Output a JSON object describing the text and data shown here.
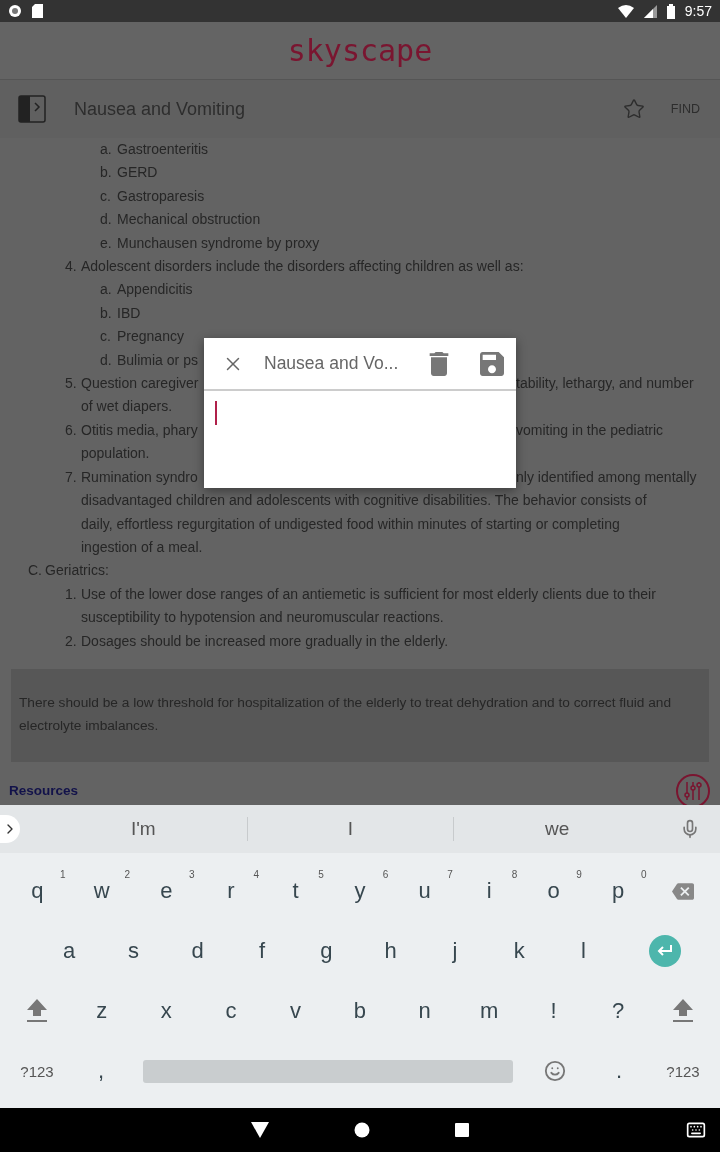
{
  "status_bar": {
    "time": "9:57"
  },
  "app_bar": {
    "logo": "skyscape"
  },
  "title_bar": {
    "title": "Nausea and Vomiting",
    "find": "FIND"
  },
  "content": {
    "blocks": [
      {
        "kind": "sub",
        "marker": "a.",
        "text": "Gastroenteritis"
      },
      {
        "kind": "sub",
        "marker": "b.",
        "text": "GERD"
      },
      {
        "kind": "sub",
        "marker": "c.",
        "text": "Gastroparesis"
      },
      {
        "kind": "sub",
        "marker": "d.",
        "text": "Mechanical obstruction"
      },
      {
        "kind": "sub",
        "marker": "e.",
        "text": "Munchausen syndrome by proxy"
      },
      {
        "kind": "num",
        "marker": "4.",
        "text": "Adolescent disorders include the disorders affecting children as well as:"
      },
      {
        "kind": "sub",
        "marker": "a.",
        "text": "Appendicitis"
      },
      {
        "kind": "sub",
        "marker": "b.",
        "text": "IBD"
      },
      {
        "kind": "sub",
        "marker": "c.",
        "text": "Pregnancy"
      },
      {
        "kind": "sub",
        "marker": "d.",
        "text": "Bulimia or ps"
      },
      {
        "kind": "num",
        "marker": "5.",
        "lines": [
          {
            "left": "Question caregiver",
            "right": "tability, lethargy, and number"
          },
          {
            "left": "of wet diapers."
          }
        ]
      },
      {
        "kind": "num",
        "marker": "6.",
        "lines": [
          {
            "left": "Otitis media, phary",
            "right": "vomiting in the pediatric"
          },
          {
            "left": "population."
          }
        ]
      },
      {
        "kind": "num",
        "marker": "7.",
        "lines": [
          {
            "left": "Rumination syndro",
            "right": "nly identified among mentally"
          },
          {
            "left": "disadvantaged children and adolescents with cognitive disabilities. The behavior consists of"
          },
          {
            "left": "daily, effortless regurgitation of undigested food within minutes of starting or completing"
          },
          {
            "left": "ingestion of a meal."
          }
        ]
      },
      {
        "kind": "head",
        "marker": "C.",
        "text": "Geriatrics:"
      },
      {
        "kind": "num",
        "marker": "1.",
        "text": "Use of the lower dose ranges of an antiemetic is sufficient for most elderly clients due to their susceptibility to hypotension and neuromuscular reactions."
      },
      {
        "kind": "num",
        "marker": "2.",
        "text": "Dosages should be increased more gradually in the elderly."
      }
    ],
    "note": "There should be a low threshold for hospitalization of the elderly to treat dehydration and to correct fluid and electrolyte imbalances.",
    "resources": "Resources"
  },
  "dialog": {
    "title": "Nausea and Vo..."
  },
  "keyboard": {
    "suggestions": [
      "I'm",
      "I",
      "we"
    ],
    "row1": [
      {
        "kind": "letter",
        "label": "q",
        "hint": "1"
      },
      {
        "kind": "letter",
        "label": "w",
        "hint": "2"
      },
      {
        "kind": "letter",
        "label": "e",
        "hint": "3"
      },
      {
        "kind": "letter",
        "label": "r",
        "hint": "4"
      },
      {
        "kind": "letter",
        "label": "t",
        "hint": "5"
      },
      {
        "kind": "letter",
        "label": "y",
        "hint": "6"
      },
      {
        "kind": "letter",
        "label": "u",
        "hint": "7"
      },
      {
        "kind": "letter",
        "label": "i",
        "hint": "8"
      },
      {
        "kind": "letter",
        "label": "o",
        "hint": "9"
      },
      {
        "kind": "letter",
        "label": "p",
        "hint": "0"
      },
      {
        "kind": "backspace"
      }
    ],
    "row2": [
      {
        "kind": "letter",
        "label": "a"
      },
      {
        "kind": "letter",
        "label": "s"
      },
      {
        "kind": "letter",
        "label": "d"
      },
      {
        "kind": "letter",
        "label": "f"
      },
      {
        "kind": "letter",
        "label": "g"
      },
      {
        "kind": "letter",
        "label": "h"
      },
      {
        "kind": "letter",
        "label": "j"
      },
      {
        "kind": "letter",
        "label": "k"
      },
      {
        "kind": "letter",
        "label": "l"
      },
      {
        "kind": "enter"
      }
    ],
    "row3": [
      {
        "kind": "shift"
      },
      {
        "kind": "letter",
        "label": "z"
      },
      {
        "kind": "letter",
        "label": "x"
      },
      {
        "kind": "letter",
        "label": "c"
      },
      {
        "kind": "letter",
        "label": "v"
      },
      {
        "kind": "letter",
        "label": "b"
      },
      {
        "kind": "letter",
        "label": "n"
      },
      {
        "kind": "letter",
        "label": "m"
      },
      {
        "kind": "letter",
        "label": "!"
      },
      {
        "kind": "letter",
        "label": "?"
      },
      {
        "kind": "shift"
      }
    ],
    "row4": [
      {
        "kind": "small",
        "label": "?123"
      },
      {
        "kind": "letter",
        "label": ","
      },
      {
        "kind": "space"
      },
      {
        "kind": "emoji"
      },
      {
        "kind": "letter",
        "label": "."
      },
      {
        "kind": "small",
        "label": "?123"
      }
    ]
  }
}
